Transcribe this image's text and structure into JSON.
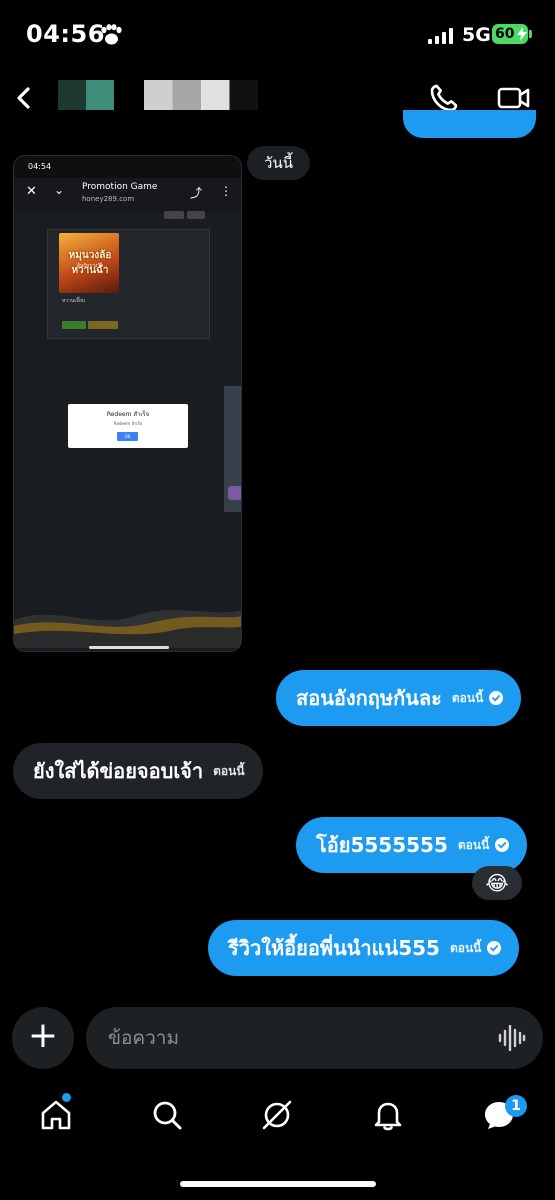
{
  "status_bar": {
    "time": "04:56",
    "network": "5G",
    "battery": "60"
  },
  "header": {
    "back": "back-icon",
    "actions": [
      "phone-icon",
      "video-icon"
    ]
  },
  "date_chip": "วันนี้",
  "attachment": {
    "status_time": "04:54",
    "browser": {
      "title": "Promotion Game",
      "url": "honey289.com"
    },
    "promo_title": "หมุนวงล้อ หวานฉ่ำ",
    "promo_sub": "ลุ้นรับรางวัล",
    "promo_label": "หวานเจี๊ยบ",
    "dialog": {
      "title": "Redeem สำเร็จ",
      "subtitle": "Redeem สำเร็จ",
      "ok": "OK"
    }
  },
  "messages": [
    {
      "text": "สอนอังกฤษกันละ",
      "time": "ตอนนี้",
      "outgoing": true
    },
    {
      "text": "ยังใส่ได้ข่อยจอบเจ้า",
      "time": "ตอนนี้",
      "outgoing": false
    },
    {
      "text": "โอ้ย5555555",
      "time": "ตอนนี้",
      "outgoing": true,
      "reaction": "😂"
    },
    {
      "text": "รีวิวให้อี้ยอพี่นนำแน่555",
      "time": "ตอนนี้",
      "outgoing": true
    }
  ],
  "composer": {
    "placeholder": "ข้อความ"
  },
  "tab_bar": {
    "items": [
      "home-icon",
      "search-icon",
      "grok-icon",
      "bell-icon",
      "messages-icon"
    ],
    "messages_badge": "1"
  },
  "colors": {
    "accent": "#1d9bf0",
    "incoming": "#202327",
    "background": "#000000"
  }
}
